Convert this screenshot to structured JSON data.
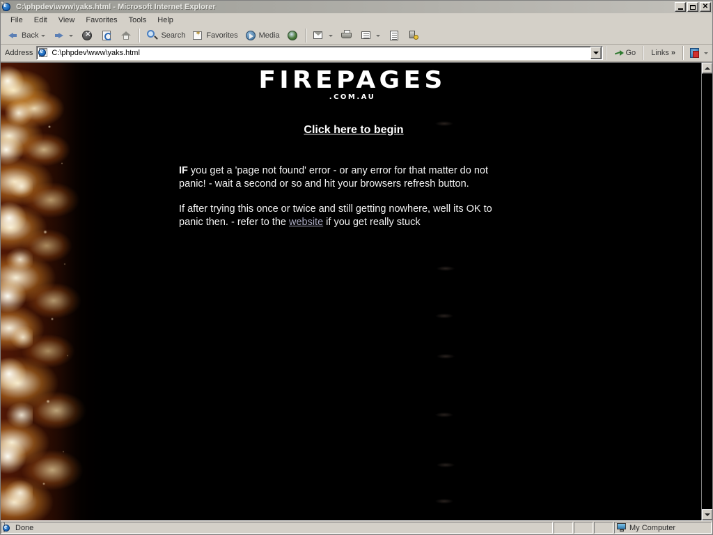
{
  "window": {
    "title": "C:\\phpdev\\www\\yaks.html - Microsoft Internet Explorer",
    "minimize_label": "",
    "maximize_label": "",
    "close_label": "✕"
  },
  "menu": {
    "items": [
      {
        "label": "File"
      },
      {
        "label": "Edit"
      },
      {
        "label": "View"
      },
      {
        "label": "Favorites"
      },
      {
        "label": "Tools"
      },
      {
        "label": "Help"
      }
    ]
  },
  "toolbar": {
    "back_label": "Back",
    "forward_label": "",
    "stop_label": "",
    "refresh_label": "",
    "home_label": "",
    "search_label": "Search",
    "favorites_label": "Favorites",
    "media_label": "Media",
    "history_label": "",
    "mail_label": "",
    "print_label": "",
    "edit_label": "",
    "discuss_label": "",
    "messenger_label": ""
  },
  "address_bar": {
    "label": "Address",
    "value": "C:\\phpdev\\www\\yaks.html",
    "placeholder": "",
    "go_label": "Go",
    "links_label": "Links",
    "links_chevrons": "»"
  },
  "page": {
    "logo_main": "FIREPAGES",
    "logo_sub": ".COM.AU",
    "begin_link": "Click here to begin",
    "paragraph1_strong": "IF",
    "paragraph1_rest": " you get a 'page not found' error - or any error for that matter do not panic! - wait a second or so and hit your browsers refresh button.",
    "paragraph2_start": "If after trying this once or twice and still getting nowhere, well its OK to panic then. - refer to the ",
    "paragraph2_link": "website",
    "paragraph2_end": " if you get really stuck",
    "background_color": "#000000",
    "text_color": "#f2f2f2",
    "link_color": "#ffffff",
    "visited_link_color": "#a8a8c0"
  },
  "statusbar": {
    "status_text": "Done",
    "zone_text": "My Computer"
  }
}
